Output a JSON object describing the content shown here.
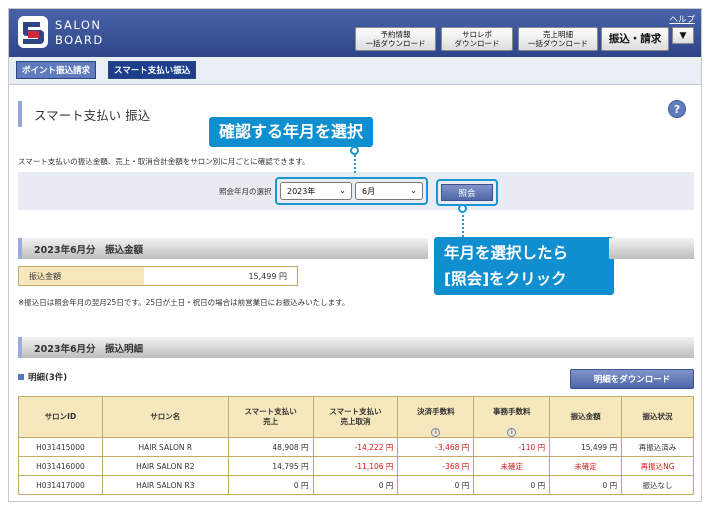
{
  "header": {
    "logo_line1": "SALON",
    "logo_line2": "BOARD",
    "help_label": "ヘルプ",
    "buttons": [
      {
        "label": "予約情報\n一括ダウンロード"
      },
      {
        "label": "サロレポ\nダウンロード"
      },
      {
        "label": "売上明細\n一括ダウンロード"
      },
      {
        "label": "振込・請求"
      }
    ],
    "dropdown_glyph": "▼"
  },
  "subnav": {
    "tabs": [
      {
        "label": "ポイント振込請求"
      },
      {
        "label": "スマート支払い振込"
      }
    ]
  },
  "page": {
    "title": "スマート支払い 振込",
    "help_glyph": "?",
    "description": "スマート支払いの振込金額、売上・取消合計金額をサロン別に月ごとに確認できます。"
  },
  "filter": {
    "label": "照会年月の選択",
    "year_value": "2023年",
    "month_value": "6月",
    "query_label": "照会"
  },
  "callouts": {
    "top": "確認する年月を選択",
    "bottom_line1": "年月を選択したら",
    "bottom_line2": "[照会]をクリック"
  },
  "summary": {
    "section_title": "2023年6月分　振込金額",
    "amount_label": "振込金額",
    "amount_value": "15,499 円",
    "note": "※振込日は照会年月の翌月25日です。25日が土日・祝日の場合は前営業日にお振込みいたします。"
  },
  "details": {
    "section_title": "2023年6月分　振込明細",
    "count_label": "明細(3件)",
    "download_label": "明細をダウンロード",
    "columns": [
      "サロンID",
      "サロン名",
      "スマート支払い\n売上",
      "スマート支払い\n売上取消",
      "決済手数料",
      "事務手数料",
      "振込金額",
      "振込状況"
    ],
    "info_glyph": "i",
    "rows": [
      [
        "H031415000",
        "HAIR SALON R",
        "48,908 円",
        "-14,222 円",
        "-3,468 円",
        "-110 円",
        "15,499 円",
        "再振込済み"
      ],
      [
        "H031416000",
        "HAIR SALON R2",
        "14,795 円",
        "-11,106 円",
        "-368 円",
        "未確定",
        "未確定",
        "再振込NG"
      ],
      [
        "H031417000",
        "HAIR SALON R3",
        "0 円",
        "0 円",
        "0 円",
        "0 円",
        "0 円",
        "振込なし"
      ]
    ]
  },
  "colors": {
    "header_blue": "#2e4688",
    "callout_blue": "#0f8fd0",
    "negative_red": "#d11a1a",
    "table_header": "#f6e7bd"
  }
}
